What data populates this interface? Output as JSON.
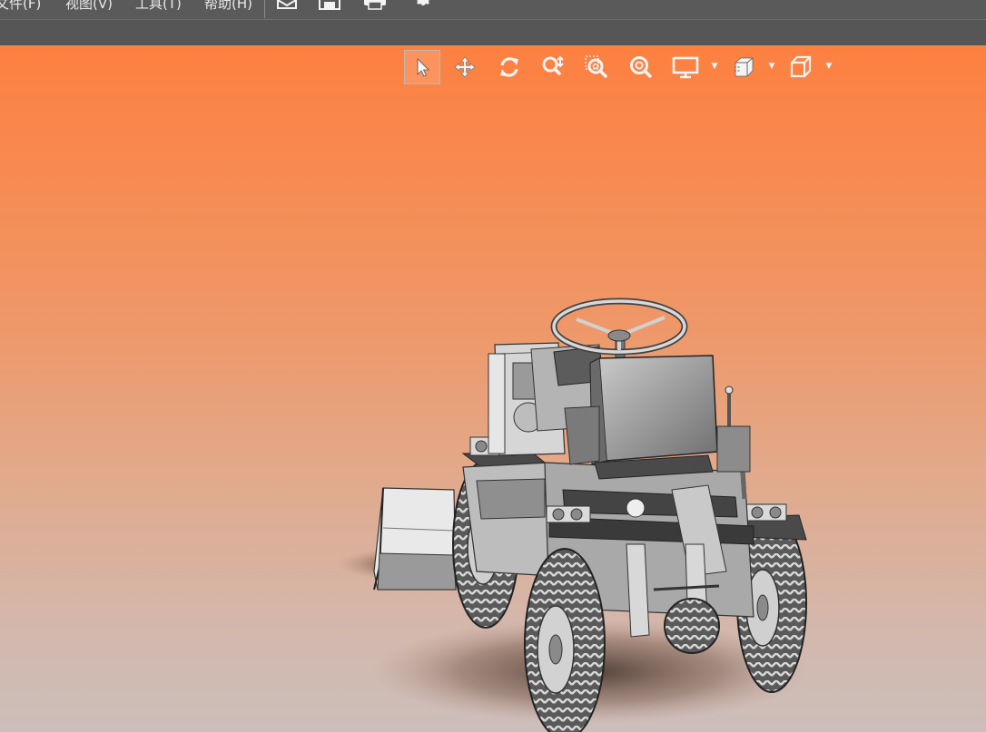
{
  "menubar": {
    "items": [
      {
        "label": "文件(F)"
      },
      {
        "label": "视图(V)"
      },
      {
        "label": "工具(T)"
      },
      {
        "label": "帮助(H)"
      }
    ],
    "toolbar_icons": [
      "open-icon",
      "save-icon",
      "print-icon",
      "settings-gear-icon"
    ]
  },
  "viewport": {
    "background_top": "#fd8040",
    "background_bottom": "#ccbebb",
    "toolbar": {
      "tools": [
        {
          "icon": "select-pointer-icon",
          "active": true
        },
        {
          "icon": "pan-move-icon",
          "active": false
        },
        {
          "icon": "rotate-icon",
          "active": false
        },
        {
          "icon": "zoom-icon",
          "active": false
        },
        {
          "icon": "zoom-window-icon",
          "active": false
        },
        {
          "icon": "zoom-fit-icon",
          "active": false
        },
        {
          "icon": "display-mode-icon",
          "dropdown": true
        },
        {
          "icon": "section-view-icon",
          "dropdown": true
        },
        {
          "icon": "view-orientation-cube-icon",
          "dropdown": true
        }
      ]
    },
    "model": {
      "description_icon": "tractor-loader-model"
    }
  },
  "colors": {
    "menubar_bg": "#5a5a5a",
    "subbar_bg": "#565656",
    "icon_white": "#f4f4f4"
  }
}
